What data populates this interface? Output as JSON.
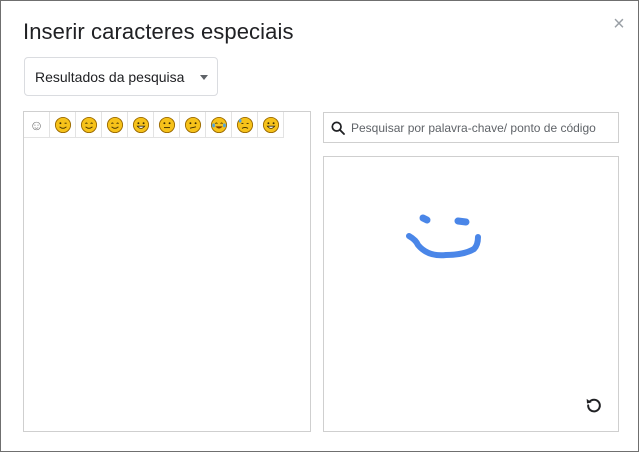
{
  "dialog": {
    "title": "Inserir caracteres especiais",
    "close_icon": "close-icon"
  },
  "category_dropdown": {
    "selected": "Resultados da pesquisa",
    "icon": "caret-down-icon"
  },
  "results": [
    {
      "name": "smiley-outline",
      "glyph": "☺"
    },
    {
      "name": "wink-face",
      "glyph": "😉"
    },
    {
      "name": "smiling-face",
      "glyph": "😊"
    },
    {
      "name": "relieved-face",
      "glyph": "😌"
    },
    {
      "name": "grinning-face",
      "glyph": "😀"
    },
    {
      "name": "neutral-face",
      "glyph": "😐"
    },
    {
      "name": "confused-face",
      "glyph": "😕"
    },
    {
      "name": "tears-of-joy-face",
      "glyph": "😂"
    },
    {
      "name": "sweat-face",
      "glyph": "😓"
    },
    {
      "name": "big-grin-face",
      "glyph": "😃"
    }
  ],
  "search": {
    "placeholder": "Pesquisar por palavra-chave/ ponto de código",
    "value": "",
    "icon": "search-icon"
  },
  "drawing": {
    "stroke_color": "#4a86e8",
    "reset_icon": "reset-icon"
  },
  "colors": {
    "emoji_fill": "#f6c21a",
    "emoji_outline": "#9b6a00",
    "icon_gray": "#5f6368"
  }
}
